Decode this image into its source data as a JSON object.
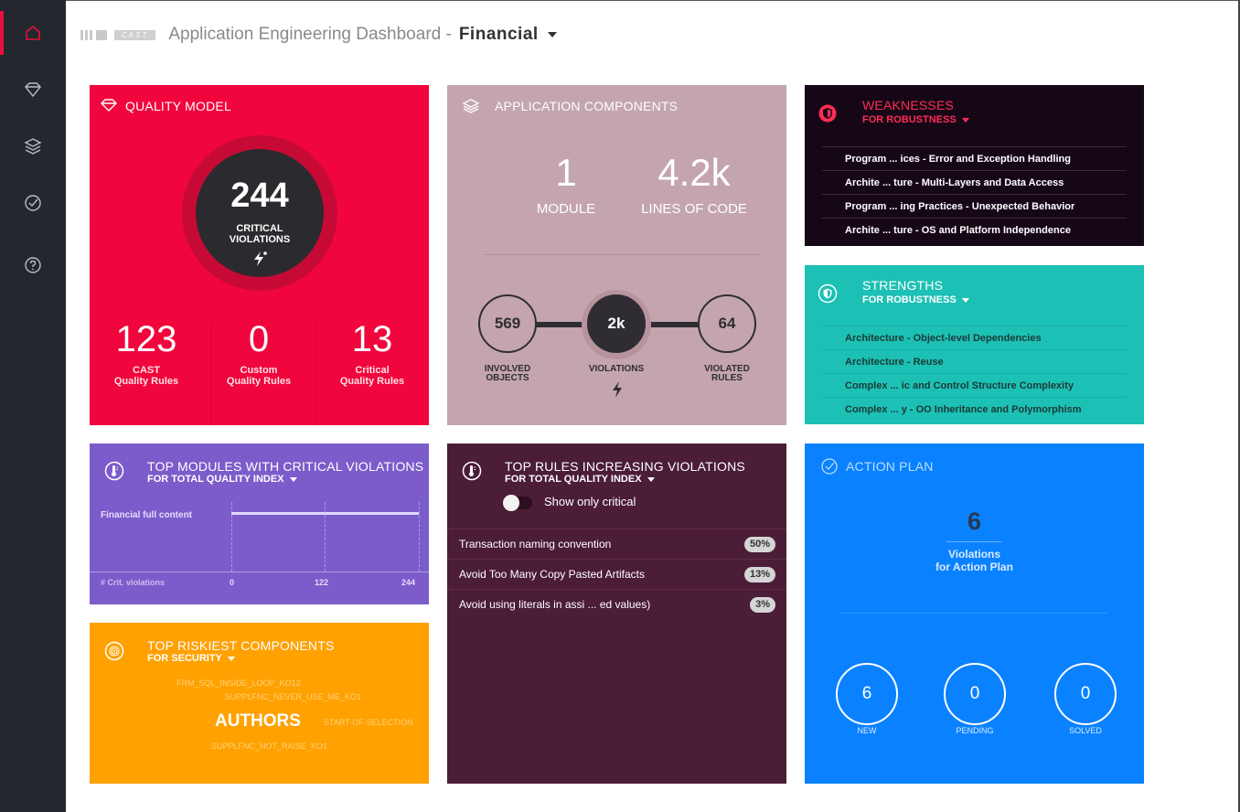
{
  "header": {
    "logo_text": "CAST",
    "title": "Application Engineering Dashboard -",
    "app_name": "Financial"
  },
  "sidebar": {
    "items": [
      {
        "name": "home",
        "icon": "home-icon"
      },
      {
        "name": "quality-model",
        "icon": "diamond-icon"
      },
      {
        "name": "components",
        "icon": "layers-icon"
      },
      {
        "name": "action-plan",
        "icon": "check-circle-icon"
      },
      {
        "name": "help",
        "icon": "question-icon"
      }
    ]
  },
  "quality_model": {
    "title": "Quality Model",
    "critical_violations": "244",
    "critical_label_1": "CRITICAL",
    "critical_label_2": "VIOLATIONS",
    "stats": [
      {
        "value": "123",
        "label_1": "CAST",
        "label_2": "Quality Rules"
      },
      {
        "value": "0",
        "label_1": "Custom",
        "label_2": "Quality Rules"
      },
      {
        "value": "13",
        "label_1": "Critical",
        "label_2": "Quality Rules"
      }
    ]
  },
  "app_components": {
    "title": "Application Components",
    "modules": "1",
    "modules_label": "MODULE",
    "loc": "4.2k",
    "loc_label": "LINES OF CODE",
    "involved_objects": "569",
    "involved_label_1": "INVOLVED",
    "involved_label_2": "OBJECTS",
    "violations": "2k",
    "violations_label": "VIOLATIONS",
    "violated_rules": "64",
    "violated_label_1": "VIOLATED",
    "violated_label_2": "RULES"
  },
  "weaknesses": {
    "title": "Weaknesses",
    "filter": "FOR ROBUSTNESS",
    "items": [
      "Program ... ices - Error and Exception Handling",
      "Archite ... ture - Multi-Layers and Data Access",
      "Program ... ing Practices - Unexpected Behavior",
      "Archite ... ture - OS and Platform Independence"
    ]
  },
  "strengths": {
    "title": "Strengths",
    "filter": "FOR ROBUSTNESS",
    "items": [
      "Architecture - Object-level Dependencies",
      "Architecture - Reuse",
      "Complex ... ic and Control Structure Complexity",
      "Complex ... y - OO Inheritance and Polymorphism"
    ]
  },
  "top_modules": {
    "title": "Top Modules with Critical Violations",
    "filter": "FOR TOTAL QUALITY INDEX",
    "module_label": "Financial full content",
    "axis_label": "# Crit. violations",
    "ticks": [
      "0",
      "122",
      "244"
    ]
  },
  "top_rules": {
    "title": "Top Rules Increasing Violations",
    "filter": "FOR TOTAL QUALITY INDEX",
    "toggle_label": "Show only critical",
    "rows": [
      {
        "name": "Transaction naming convention",
        "pct": "50%"
      },
      {
        "name": "Avoid Too Many Copy Pasted Artifacts",
        "pct": "13%"
      },
      {
        "name": "Avoid using literals in assi ... ed values)",
        "pct": "3%"
      }
    ]
  },
  "riskiest": {
    "title": "Top Riskiest Components",
    "filter": "FOR SECURITY",
    "cloud": [
      "FRM_SQL_INSIDE_LOOP_KO12",
      "SUPPLFNC_NEVER_USE_ME_KO1",
      "START-OF-SELECTION",
      "SUPPLFNC_NOT_RAISE_KO1"
    ],
    "highlight": "AUTHORS"
  },
  "action_plan": {
    "title": "Action Plan",
    "total": "6",
    "label_1": "Violations",
    "label_2": "for Action Plan",
    "states": [
      {
        "value": "6",
        "label": "NEW"
      },
      {
        "value": "0",
        "label": "PENDING"
      },
      {
        "value": "0",
        "label": "SOLVED"
      }
    ]
  },
  "colors": {
    "quality_model": "#f0063c",
    "app_components": "#c4a5ae",
    "weaknesses": "#160717",
    "strengths": "#1dc0b4",
    "top_modules": "#7c5cca",
    "top_rules": "#4b1d37",
    "riskiest": "#ffa100",
    "action_plan": "#0a82ff",
    "sidebar": "#22282d",
    "accent": "#e8103c"
  }
}
